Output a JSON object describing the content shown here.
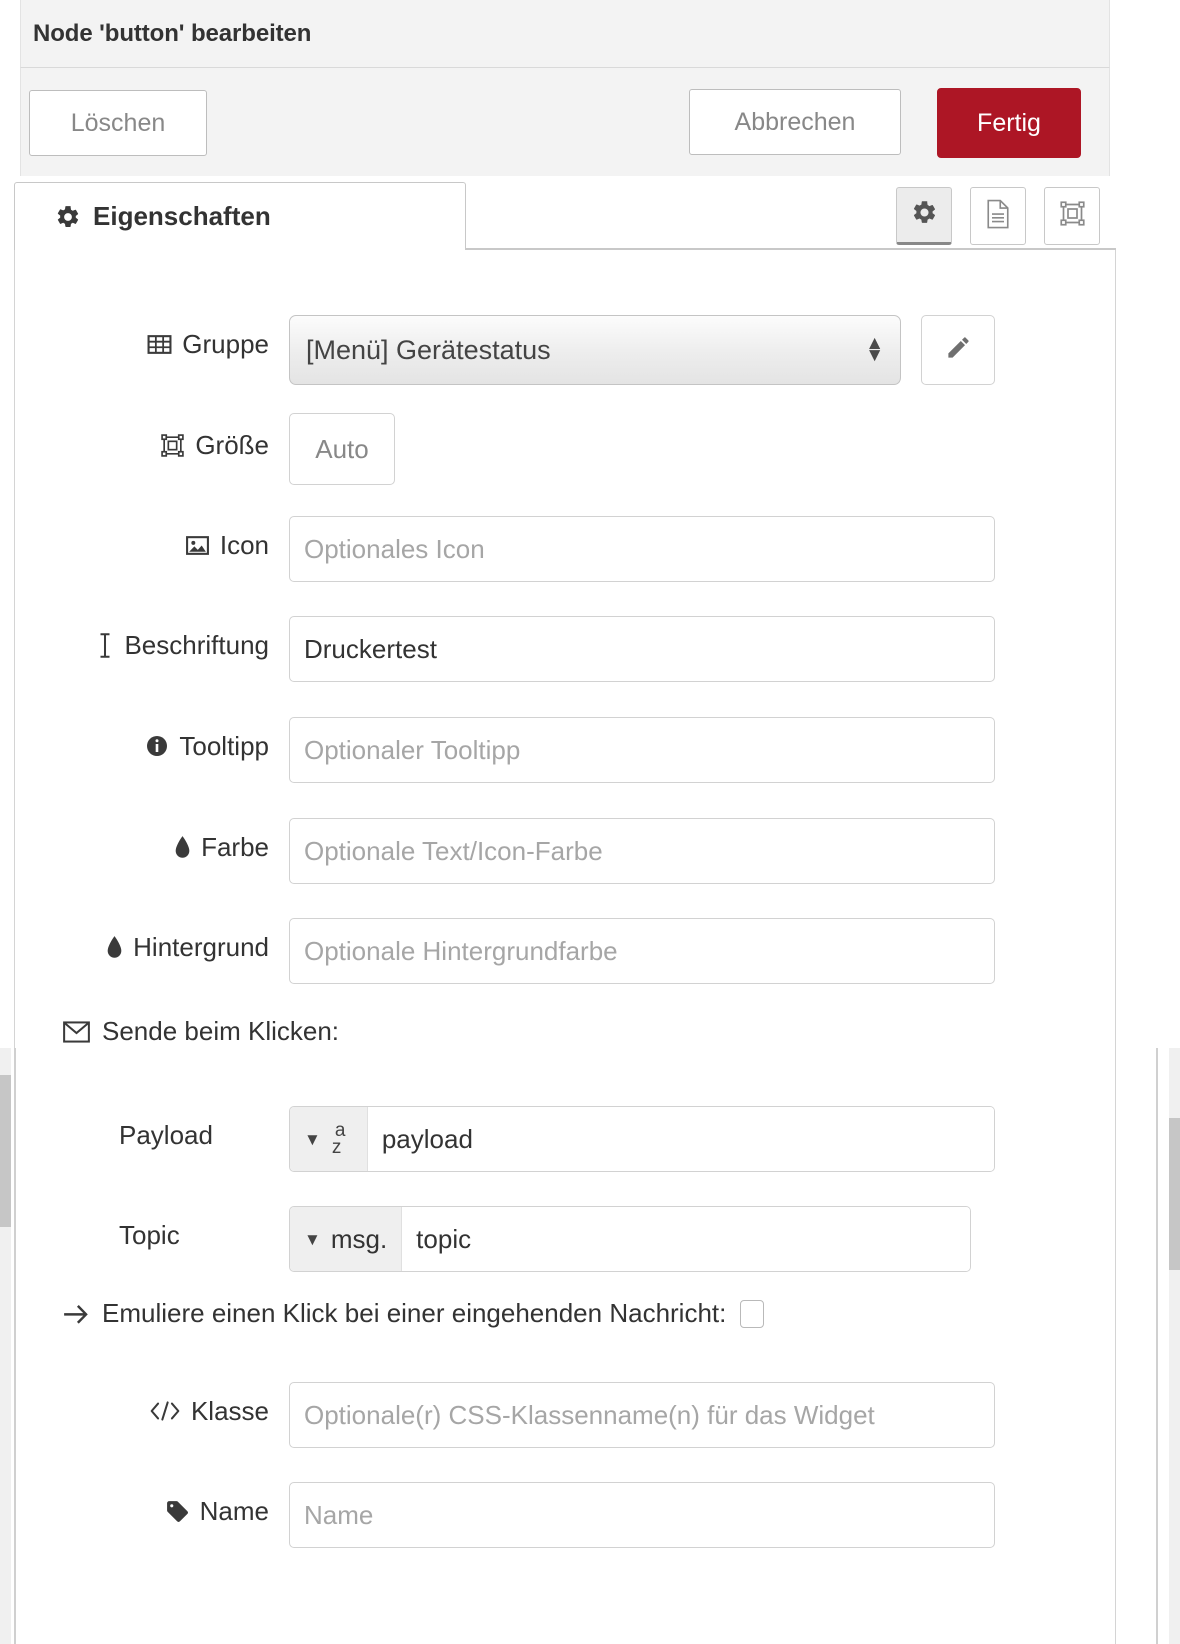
{
  "dialog": {
    "title": "Node 'button' bearbeiten"
  },
  "toolbar": {
    "delete_label": "Löschen",
    "cancel_label": "Abbrechen",
    "done_label": "Fertig",
    "done_color": "#ad1625"
  },
  "tabs": {
    "items": [
      {
        "label": "Eigenschaften",
        "icon": "gear-icon",
        "active": true
      }
    ],
    "icon_buttons": [
      {
        "name": "gear-icon",
        "active": true
      },
      {
        "name": "document-icon",
        "active": false
      },
      {
        "name": "layout-resize-icon",
        "active": false
      }
    ]
  },
  "form": {
    "group": {
      "label": "Gruppe",
      "icon": "table-grid-icon",
      "value": "[Menü] Gerätestatus",
      "edit_button_icon": "pencil-icon"
    },
    "size": {
      "label": "Größe",
      "icon": "layout-resize-icon",
      "value": "Auto"
    },
    "icon_field": {
      "label": "Icon",
      "icon": "image-icon",
      "value": "",
      "placeholder": "Optionales Icon"
    },
    "label_field": {
      "label": "Beschriftung",
      "icon": "text-cursor-icon",
      "value": "Druckertest",
      "placeholder": ""
    },
    "tooltip": {
      "label": "Tooltipp",
      "icon": "info-circle-icon",
      "value": "",
      "placeholder": "Optionaler Tooltipp"
    },
    "color": {
      "label": "Farbe",
      "icon": "droplet-icon",
      "value": "",
      "placeholder": "Optionale Text/Icon-Farbe"
    },
    "background": {
      "label": "Hintergrund",
      "icon": "droplet-icon",
      "value": "",
      "placeholder": "Optionale Hintergrundfarbe"
    },
    "send_on_click": {
      "header": "Sende beim Klicken:",
      "header_icon": "envelope-icon",
      "payload": {
        "label": "Payload",
        "type_icon": "az-string-icon",
        "value": "payload"
      },
      "topic": {
        "label": "Topic",
        "type_prefix": "msg.",
        "value": "topic"
      }
    },
    "emulate": {
      "label": "Emuliere einen Klick bei einer eingehenden Nachricht:",
      "icon": "arrow-right-icon",
      "checked": false
    },
    "css_class": {
      "label": "Klasse",
      "icon": "code-brackets-icon",
      "value": "",
      "placeholder": "Optionale(r) CSS-Klassenname(n) für das Widget"
    },
    "name": {
      "label": "Name",
      "icon": "tag-icon",
      "value": "",
      "placeholder": "Name"
    }
  }
}
